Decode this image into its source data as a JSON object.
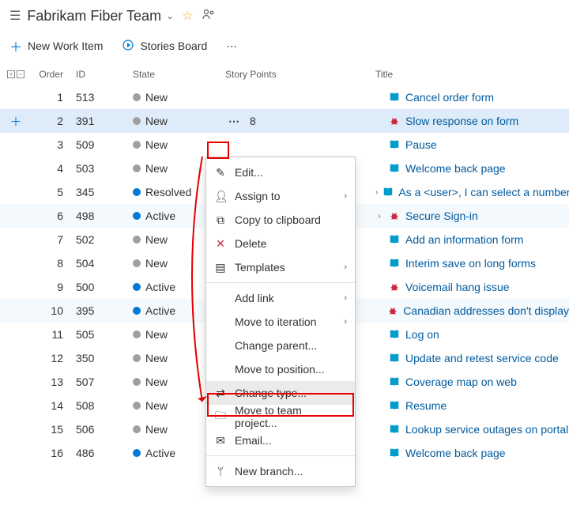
{
  "header": {
    "title": "Fabrikam Fiber Team"
  },
  "toolbar": {
    "new_item": "New Work Item",
    "stories_board": "Stories Board"
  },
  "columns": {
    "order": "Order",
    "id": "ID",
    "state": "State",
    "story_points": "Story Points",
    "title": "Title"
  },
  "rows": [
    {
      "order": 1,
      "id": 513,
      "state": "New",
      "state_color": "gray",
      "points": "",
      "expand": false,
      "icon": "book",
      "title": "Cancel order form"
    },
    {
      "order": 2,
      "id": 391,
      "state": "New",
      "state_color": "gray",
      "points": "8",
      "expand": false,
      "icon": "bug",
      "title": "Slow response on form",
      "selected": true
    },
    {
      "order": 3,
      "id": 509,
      "state": "New",
      "state_color": "gray",
      "points": "",
      "expand": false,
      "icon": "book",
      "title": "Pause"
    },
    {
      "order": 4,
      "id": 503,
      "state": "New",
      "state_color": "gray",
      "points": "",
      "expand": false,
      "icon": "book",
      "title": "Welcome back page"
    },
    {
      "order": 5,
      "id": 345,
      "state": "Resolved",
      "state_color": "blue",
      "points": "",
      "expand": true,
      "icon": "book",
      "title": "As a <user>, I can select a number ..."
    },
    {
      "order": 6,
      "id": 498,
      "state": "Active",
      "state_color": "blue",
      "points": "",
      "expand": true,
      "icon": "bug",
      "title": "Secure Sign-in",
      "hover": true
    },
    {
      "order": 7,
      "id": 502,
      "state": "New",
      "state_color": "gray",
      "points": "",
      "expand": false,
      "icon": "book",
      "title": "Add an information form"
    },
    {
      "order": 8,
      "id": 504,
      "state": "New",
      "state_color": "gray",
      "points": "",
      "expand": false,
      "icon": "book",
      "title": "Interim save on long forms"
    },
    {
      "order": 9,
      "id": 500,
      "state": "Active",
      "state_color": "blue",
      "points": "",
      "expand": false,
      "icon": "bug",
      "title": "Voicemail hang issue"
    },
    {
      "order": 10,
      "id": 395,
      "state": "Active",
      "state_color": "blue",
      "points": "",
      "expand": false,
      "icon": "bug",
      "title": "Canadian addresses don't display",
      "hover": true
    },
    {
      "order": 11,
      "id": 505,
      "state": "New",
      "state_color": "gray",
      "points": "",
      "expand": false,
      "icon": "book",
      "title": "Log on"
    },
    {
      "order": 12,
      "id": 350,
      "state": "New",
      "state_color": "gray",
      "points": "",
      "expand": false,
      "icon": "book",
      "title": "Update and retest service code"
    },
    {
      "order": 13,
      "id": 507,
      "state": "New",
      "state_color": "gray",
      "points": "",
      "expand": false,
      "icon": "book",
      "title": "Coverage map on web"
    },
    {
      "order": 14,
      "id": 508,
      "state": "New",
      "state_color": "gray",
      "points": "",
      "expand": false,
      "icon": "book",
      "title": "Resume"
    },
    {
      "order": 15,
      "id": 506,
      "state": "New",
      "state_color": "gray",
      "points": "",
      "expand": false,
      "icon": "book",
      "title": "Lookup service outages on portal"
    },
    {
      "order": 16,
      "id": 486,
      "state": "Active",
      "state_color": "blue",
      "points": "",
      "expand": false,
      "icon": "book",
      "title": "Welcome back page"
    }
  ],
  "context_menu": [
    {
      "icon": "edit",
      "label": "Edit...",
      "sub": false
    },
    {
      "icon": "person",
      "label": "Assign to",
      "sub": true
    },
    {
      "icon": "copy",
      "label": "Copy to clipboard",
      "sub": false
    },
    {
      "icon": "delete",
      "label": "Delete",
      "sub": false,
      "red": true
    },
    {
      "icon": "template",
      "label": "Templates",
      "sub": true
    },
    {
      "sep": true
    },
    {
      "icon": "",
      "label": "Add link",
      "sub": true
    },
    {
      "icon": "",
      "label": "Move to iteration",
      "sub": true
    },
    {
      "icon": "",
      "label": "Change parent...",
      "sub": false
    },
    {
      "icon": "",
      "label": "Move to position...",
      "sub": false
    },
    {
      "icon": "swap",
      "label": "Change type...",
      "sub": false,
      "hl": true
    },
    {
      "icon": "folder",
      "label": "Move to team project...",
      "sub": false
    },
    {
      "icon": "mail",
      "label": "Email...",
      "sub": false
    },
    {
      "sep": true
    },
    {
      "icon": "branch",
      "label": "New branch...",
      "sub": false
    }
  ],
  "icons": {
    "edit": "✎",
    "person": "👤︎",
    "copy": "⧉",
    "delete": "✕",
    "template": "▤",
    "swap": "⇄",
    "folder": "🗀",
    "mail": "✉",
    "branch": "ᛘ"
  }
}
